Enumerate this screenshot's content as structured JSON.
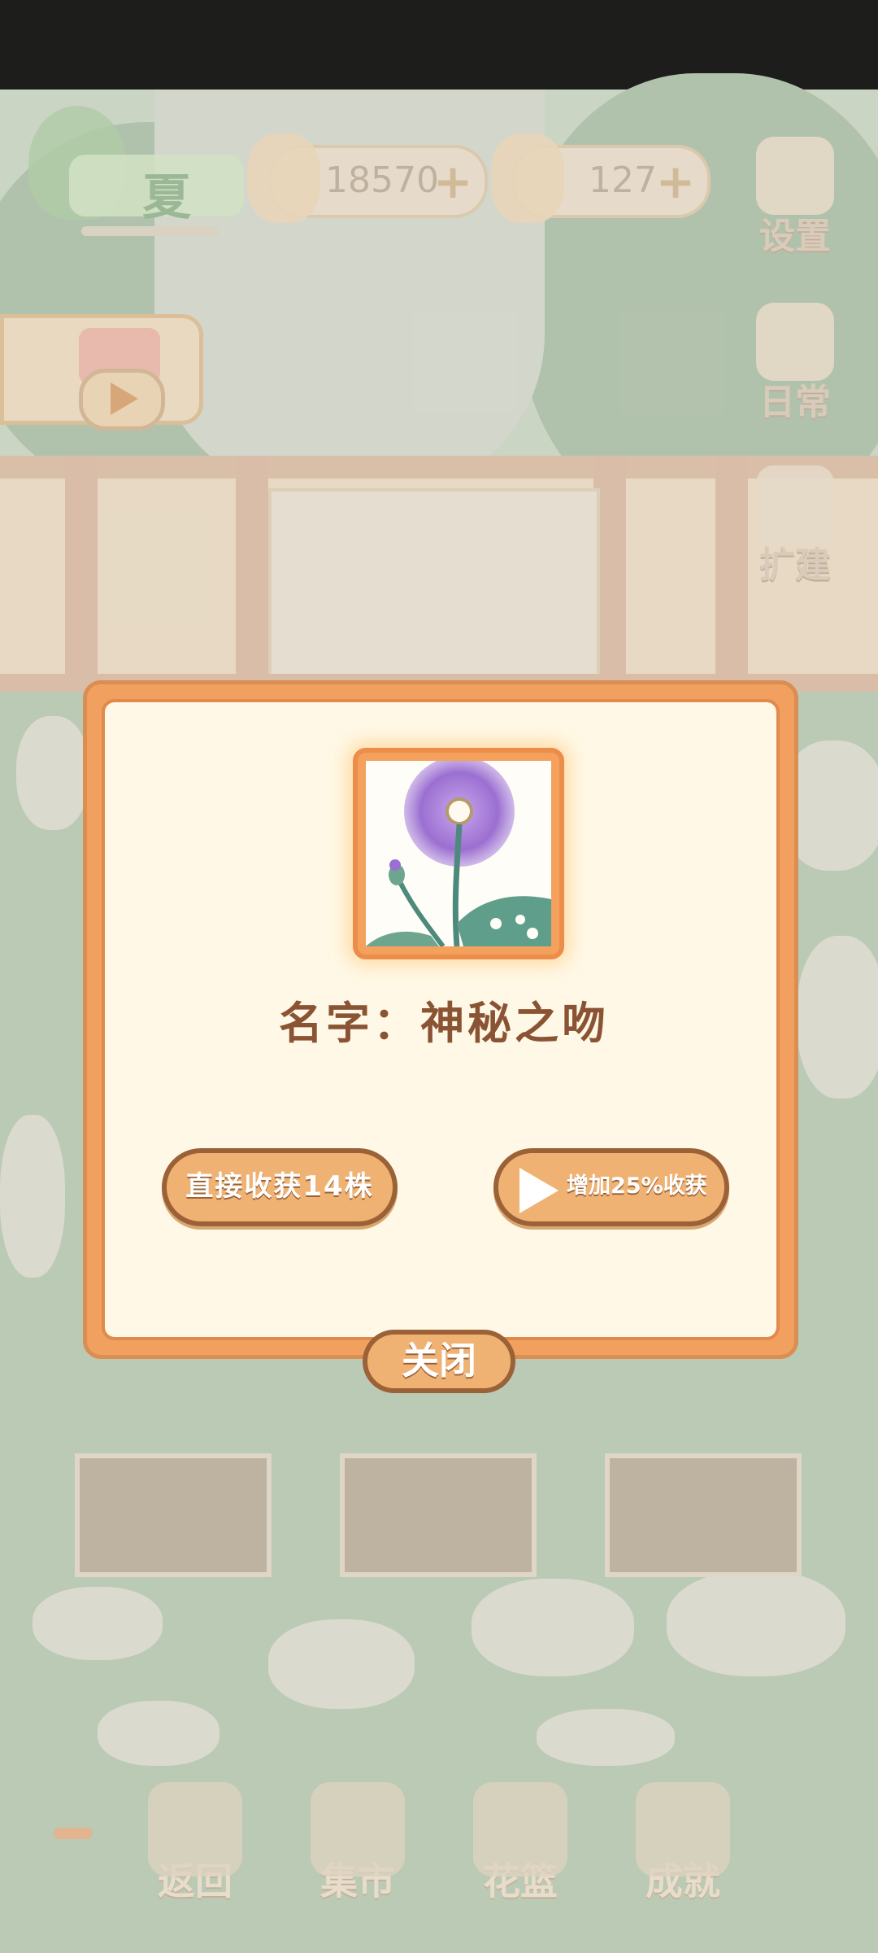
{
  "hud": {
    "season": "夏",
    "fish_coins": "18570",
    "cheese": "127"
  },
  "side_menu": {
    "settings": "设置",
    "daily": "日常",
    "expand": "扩建"
  },
  "dialog": {
    "name_text": "名字：神秘之吻",
    "harvest_button": "直接收获14株",
    "bonus_button": "增加25%收获",
    "close_button": "关闭"
  },
  "bottom_nav": {
    "back": "返回",
    "market": "集市",
    "flower_basket": "花篮",
    "achievements": "成就"
  },
  "colors": {
    "dialog_orange": "#f2a060",
    "button_fill": "#f0b273",
    "button_border": "#9b6137",
    "text_brown": "#8a5434",
    "card_cream": "#fff8e6",
    "flower_purple": "#9b6fd1"
  }
}
